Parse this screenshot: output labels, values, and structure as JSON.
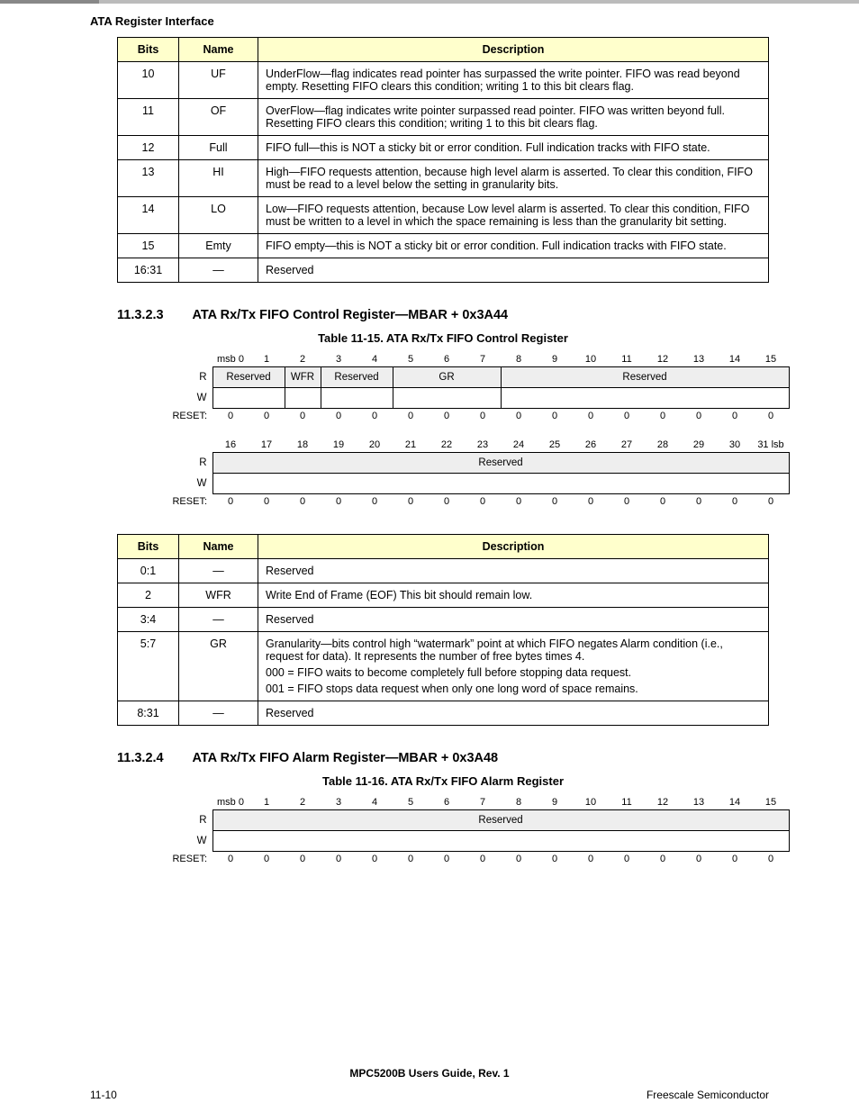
{
  "header": "ATA Register Interface",
  "table1": {
    "cols": [
      "Bits",
      "Name",
      "Description"
    ],
    "rows": [
      {
        "bits": "10",
        "name": "UF",
        "desc": "UnderFlow—flag indicates read pointer has surpassed the write pointer. FIFO was read beyond empty. Resetting FIFO clears this condition; writing 1 to this bit clears flag."
      },
      {
        "bits": "11",
        "name": "OF",
        "desc": "OverFlow—flag indicates write pointer surpassed read pointer. FIFO was written beyond full. Resetting FIFO clears this condition; writing 1 to this bit clears flag."
      },
      {
        "bits": "12",
        "name": "Full",
        "desc": "FIFO full—this is NOT a sticky bit or error condition. Full indication tracks with FIFO state."
      },
      {
        "bits": "13",
        "name": "HI",
        "desc": "High—FIFO requests attention, because high level alarm is asserted. To clear this condition, FIFO must be read to a level below the setting in granularity bits."
      },
      {
        "bits": "14",
        "name": "LO",
        "desc": "Low—FIFO requests attention, because Low level alarm is asserted. To clear this condition, FIFO must be written to a level in which the space remaining is less than the granularity bit setting."
      },
      {
        "bits": "15",
        "name": "Emty",
        "desc": "FIFO empty—this is NOT a sticky bit or error condition. Full indication tracks with FIFO state."
      },
      {
        "bits": "16:31",
        "name": "—",
        "desc": "Reserved"
      }
    ]
  },
  "section_11_3_2_3": {
    "num": "11.3.2.3",
    "title": "ATA Rx/Tx FIFO Control Register—MBAR + 0x3A44",
    "caption": "Table 11-15. ATA Rx/Tx FIFO Control Register"
  },
  "reg1": {
    "msb": "msb 0",
    "lsb": "31 lsb",
    "row_r": "R",
    "row_w": "W",
    "row_reset": "RESET:",
    "bits_hi": [
      "msb 0",
      "1",
      "2",
      "3",
      "4",
      "5",
      "6",
      "7",
      "8",
      "9",
      "10",
      "11",
      "12",
      "13",
      "14",
      "15"
    ],
    "fields_hi": {
      "reserved_a": "Reserved",
      "wfr": "WFR",
      "reserved_b": "Reserved",
      "gr": "GR",
      "reserved_c": "Reserved"
    },
    "reset_hi": [
      "0",
      "0",
      "0",
      "0",
      "0",
      "0",
      "0",
      "0",
      "0",
      "0",
      "0",
      "0",
      "0",
      "0",
      "0",
      "0"
    ],
    "bits_lo": [
      "16",
      "17",
      "18",
      "19",
      "20",
      "21",
      "22",
      "23",
      "24",
      "25",
      "26",
      "27",
      "28",
      "29",
      "30",
      "31 lsb"
    ],
    "fields_lo": {
      "reserved": "Reserved"
    },
    "reset_lo": [
      "0",
      "0",
      "0",
      "0",
      "0",
      "0",
      "0",
      "0",
      "0",
      "0",
      "0",
      "0",
      "0",
      "0",
      "0",
      "0"
    ]
  },
  "table2": {
    "cols": [
      "Bits",
      "Name",
      "Description"
    ],
    "rows": [
      {
        "bits": "0:1",
        "name": "—",
        "desc": "Reserved"
      },
      {
        "bits": "2",
        "name": "WFR",
        "desc": "Write End of Frame (EOF) This bit should remain low."
      },
      {
        "bits": "3:4",
        "name": "—",
        "desc": "Reserved"
      },
      {
        "bits": "5:7",
        "name": "GR",
        "desc": "Granularity—bits control high “watermark” point at which FIFO negates Alarm condition (i.e., request for data). It represents the number of free bytes times 4.",
        "desc2": "000 = FIFO waits to become completely full before stopping data request.",
        "desc3": "001 = FIFO stops data request when only one long word of space remains."
      },
      {
        "bits": "8:31",
        "name": "—",
        "desc": "Reserved"
      }
    ]
  },
  "section_11_3_2_4": {
    "num": "11.3.2.4",
    "title": "ATA Rx/Tx FIFO Alarm Register—MBAR + 0x3A48",
    "caption": "Table 11-16. ATA Rx/Tx FIFO Alarm Register"
  },
  "reg2": {
    "row_r": "R",
    "row_w": "W",
    "row_reset": "RESET:",
    "bits_hi": [
      "msb 0",
      "1",
      "2",
      "3",
      "4",
      "5",
      "6",
      "7",
      "8",
      "9",
      "10",
      "11",
      "12",
      "13",
      "14",
      "15"
    ],
    "fields_hi": {
      "reserved": "Reserved"
    },
    "reset_hi": [
      "0",
      "0",
      "0",
      "0",
      "0",
      "0",
      "0",
      "0",
      "0",
      "0",
      "0",
      "0",
      "0",
      "0",
      "0",
      "0"
    ]
  },
  "footer": {
    "center": "MPC5200B Users Guide, Rev. 1",
    "left": "11-10",
    "right": "Freescale Semiconductor"
  }
}
